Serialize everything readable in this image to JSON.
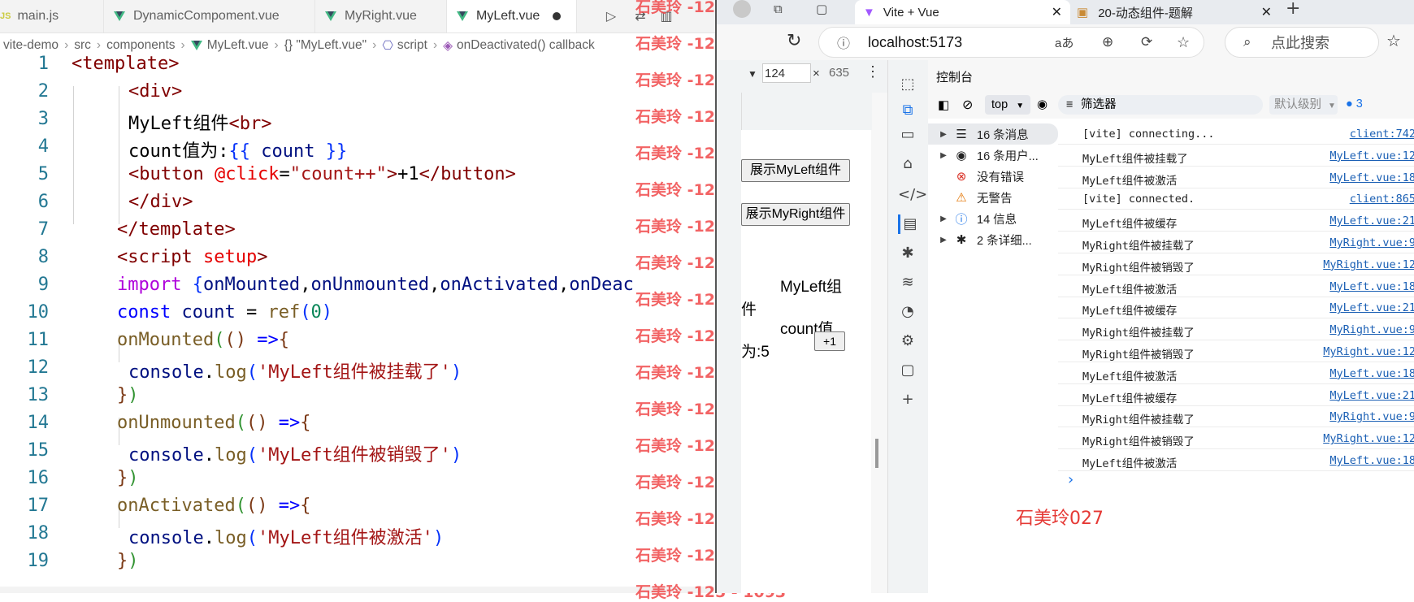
{
  "editor": {
    "tabs": [
      {
        "label": "main.js",
        "type": "js"
      },
      {
        "label": "DynamicCompoment.vue",
        "type": "vue"
      },
      {
        "label": "MyRight.vue",
        "type": "vue"
      },
      {
        "label": "MyLeft.vue",
        "type": "vue",
        "active": true,
        "modified": true
      }
    ],
    "breadcrumb": [
      "vite-demo",
      "src",
      "components",
      "MyLeft.vue",
      "{} \"MyLeft.vue\"",
      "script",
      "onDeactivated() callback"
    ],
    "line_numbers": [
      "1",
      "2",
      "3",
      "4",
      "5",
      "6",
      "7",
      "8",
      "9",
      "10",
      "11",
      "12",
      "13",
      "14",
      "15",
      "16",
      "17",
      "18",
      "19"
    ]
  },
  "watermark": "石美玲 -125 - 1093",
  "browser": {
    "tabs": [
      {
        "label": "Vite + Vue"
      },
      {
        "label": "20-动态组件-题解"
      }
    ],
    "url": "localhost:5173",
    "search_placeholder": "点此搜索",
    "device": {
      "width": "124",
      "height": "635"
    },
    "page": {
      "btn_left": "展示MyLeft组件",
      "btn_right": "展示MyRight组件",
      "title": "MyLeft组件",
      "count_label": "count值为:",
      "count_value": "5",
      "plus_button": "+1"
    },
    "devtools": {
      "title": "控制台",
      "context": "top",
      "filter_placeholder": "筛选器",
      "level": "默认级别",
      "issues_count": "3",
      "categories": [
        {
          "label": "16 条消息",
          "icon": "list-icon",
          "expandable": true
        },
        {
          "label": "16 条用户...",
          "icon": "user-icon",
          "expandable": true
        },
        {
          "label": "没有错误",
          "icon": "error-icon",
          "expandable": false
        },
        {
          "label": "无警告",
          "icon": "warning-icon",
          "expandable": false
        },
        {
          "label": "14 信息",
          "icon": "info-icon",
          "expandable": true
        },
        {
          "label": "2 条详细...",
          "icon": "bug-icon",
          "expandable": true
        }
      ],
      "logs": [
        {
          "msg": "[vite] connecting...",
          "src": "client:742"
        },
        {
          "msg": "MyLeft组件被挂载了",
          "src": "MyLeft.vue:12"
        },
        {
          "msg": "MyLeft组件被激活",
          "src": "MyLeft.vue:18"
        },
        {
          "msg": "[vite] connected.",
          "src": "client:865"
        },
        {
          "msg": "MyLeft组件被缓存",
          "src": "MyLeft.vue:21"
        },
        {
          "msg": "MyRight组件被挂载了",
          "src": "MyRight.vue:9"
        },
        {
          "msg": "MyRight组件被销毁了",
          "src": "MyRight.vue:12"
        },
        {
          "msg": "MyLeft组件被激活",
          "src": "MyLeft.vue:18"
        },
        {
          "msg": "MyLeft组件被缓存",
          "src": "MyLeft.vue:21"
        },
        {
          "msg": "MyRight组件被挂载了",
          "src": "MyRight.vue:9"
        },
        {
          "msg": "MyRight组件被销毁了",
          "src": "MyRight.vue:12"
        },
        {
          "msg": "MyLeft组件被激活",
          "src": "MyLeft.vue:18"
        },
        {
          "msg": "MyLeft组件被缓存",
          "src": "MyLeft.vue:21"
        },
        {
          "msg": "MyRight组件被挂载了",
          "src": "MyRight.vue:9"
        },
        {
          "msg": "MyRight组件被销毁了",
          "src": "MyRight.vue:12"
        },
        {
          "msg": "MyLeft组件被激活",
          "src": "MyLeft.vue:18"
        }
      ],
      "prompt": "›"
    },
    "signature": "石美玲027"
  }
}
